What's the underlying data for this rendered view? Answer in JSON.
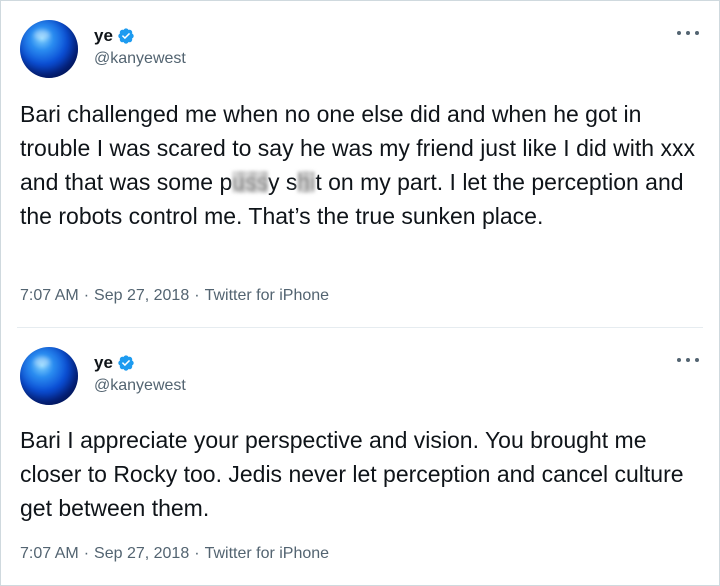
{
  "tweets": [
    {
      "name": "ye",
      "handle": "@kanyewest",
      "text_before": "Bari challenged me when no one else did and when he got in trouble I was scared to say he was my friend just like I did with xxx and that was some p",
      "censored_1": "uss",
      "text_mid": "y s",
      "censored_2": "hi",
      "text_after": "t on my part. I let the perception and the robots control me. That’s the true sunken place.",
      "time": "7:07 AM",
      "date": "Sep 27, 2018",
      "source": "Twitter for iPhone"
    },
    {
      "name": "ye",
      "handle": "@kanyewest",
      "text": "Bari I appreciate your perspective and vision. You brought me closer to Rocky too. Jedis never let perception and cancel culture get between them.",
      "time": "7:07 AM",
      "date": "Sep 27, 2018",
      "source": "Twitter for iPhone"
    }
  ],
  "separator": "·",
  "colors": {
    "verified": "#1d9bf0",
    "secondary_text": "#536471",
    "primary_text": "#0f1419",
    "border": "#cfd9de"
  },
  "icons": {
    "verified": "verified-badge-icon",
    "more": "more-horizontal-icon"
  }
}
